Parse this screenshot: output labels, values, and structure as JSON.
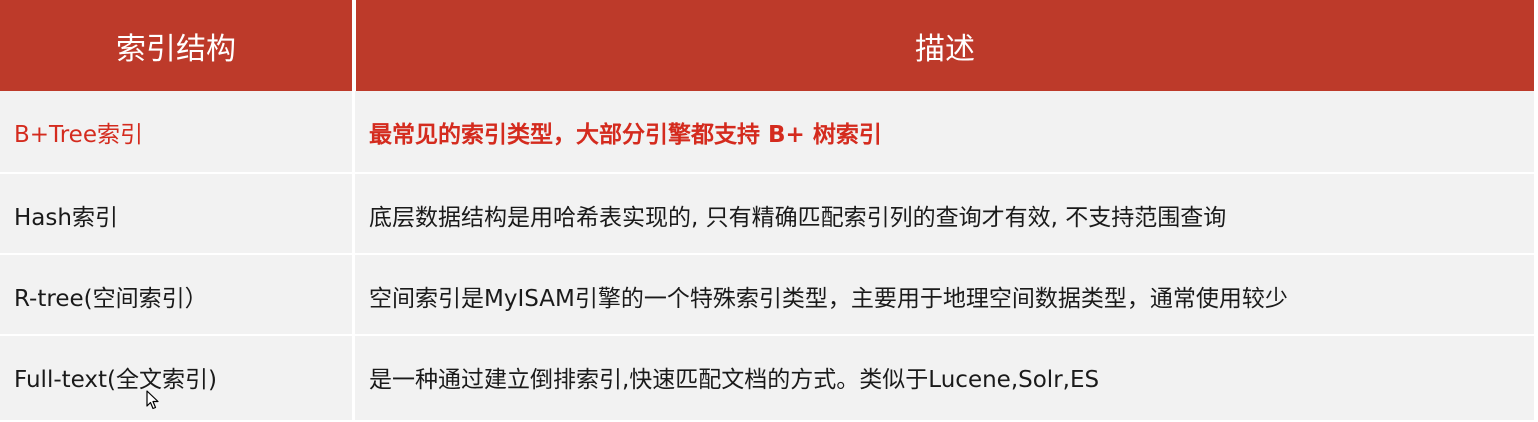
{
  "table": {
    "headers": [
      "索引结构",
      "描述"
    ],
    "rows": [
      {
        "structure": "B+Tree索引",
        "description": "最常见的索引类型，大部分引擎都支持 B+ 树索引",
        "highlight": true
      },
      {
        "structure": "Hash索引",
        "description": "底层数据结构是用哈希表实现的, 只有精确匹配索引列的查询才有效, 不支持范围查询",
        "highlight": false
      },
      {
        "structure": "R-tree(空间索引）",
        "description": "空间索引是MyISAM引擎的一个特殊索引类型，主要用于地理空间数据类型，通常使用较少",
        "highlight": false
      },
      {
        "structure": "Full-text(全文索引)",
        "description": "是一种通过建立倒排索引,快速匹配文档的方式。类似于Lucene,Solr,ES",
        "highlight": false
      }
    ]
  },
  "colors": {
    "header_bg": "#bd3a2a",
    "header_text": "#ffffff",
    "body_bg": "#f2f2f2",
    "highlight_text": "#d42b1e",
    "body_text": "#1a1a1a"
  },
  "icons": {
    "cursor": "mouse-pointer-icon"
  }
}
